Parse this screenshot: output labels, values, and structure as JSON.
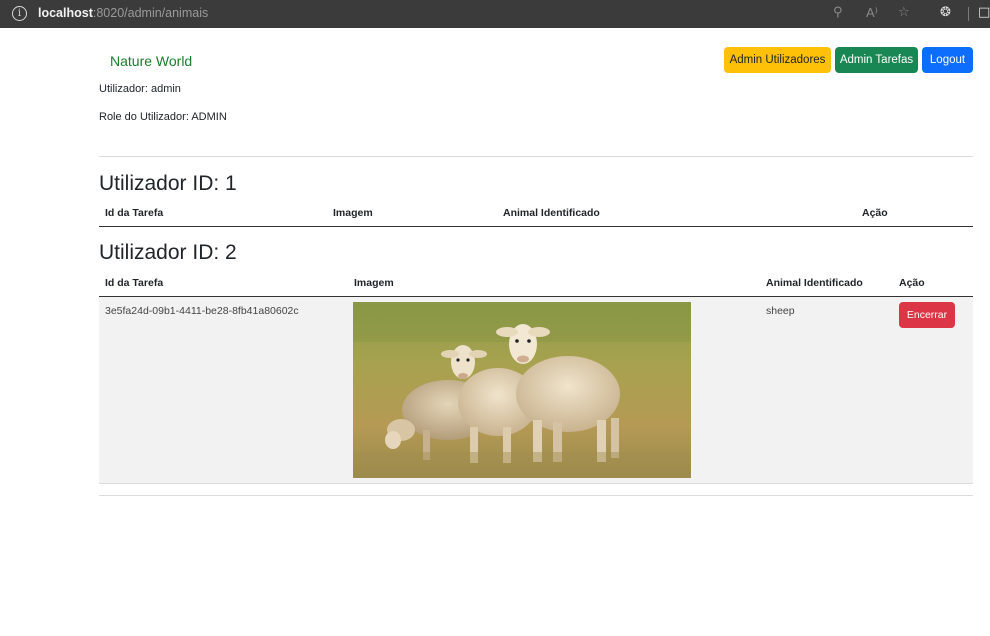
{
  "browser": {
    "url_host": "localhost",
    "url_rest": ":8020/admin/animais"
  },
  "header": {
    "brand": "Nature World",
    "user_line": "Utilizador: admin",
    "role_line": "Role do Utilizador: ADMIN",
    "buttons": {
      "admin_users": "Admin Utilizadores",
      "admin_tasks": "Admin Tarefas",
      "logout": "Logout"
    }
  },
  "sections": [
    {
      "title": "Utilizador ID: 1",
      "columns": [
        "Id da Tarefa",
        "Imagem",
        "Animal Identificado",
        "Ação"
      ],
      "rows": []
    },
    {
      "title": "Utilizador ID: 2",
      "columns": [
        "Id da Tarefa",
        "Imagem",
        "Animal Identificado",
        "Ação"
      ],
      "rows": [
        {
          "task_id": "3e5fa24d-09b1-4411-be28-8fb41a80602c",
          "animal": "sheep",
          "action": "Encerrar"
        }
      ]
    }
  ],
  "colors": {
    "brand": "#1c7c2a",
    "warning": "#ffc107",
    "success": "#198754",
    "primary": "#0d6efd",
    "danger": "#dc3545"
  }
}
